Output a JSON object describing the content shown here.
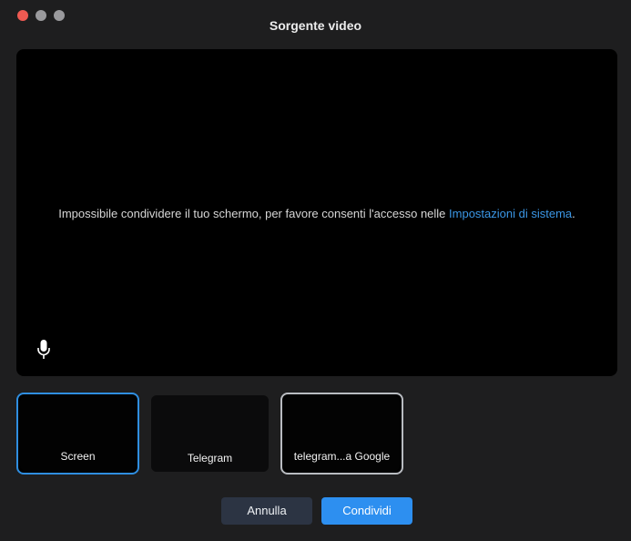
{
  "window": {
    "title": "Sorgente video"
  },
  "preview": {
    "message_before": "Impossibile condividere il tuo schermo, per favore consenti l'accesso nelle ",
    "message_link": "Impostazioni di sistema",
    "message_after": ".",
    "mic_icon": "microphone-icon"
  },
  "sources": [
    {
      "label": "Screen",
      "selected": true
    },
    {
      "label": "Telegram",
      "selected": false
    },
    {
      "label": "telegram...a Google",
      "selected": false
    }
  ],
  "buttons": {
    "cancel_label": "Annulla",
    "share_label": "Condividi"
  },
  "colors": {
    "accent": "#2d8ff0",
    "link": "#3b97e6",
    "window_bg": "#1e1e1f",
    "close_light": "#ee5a52"
  }
}
